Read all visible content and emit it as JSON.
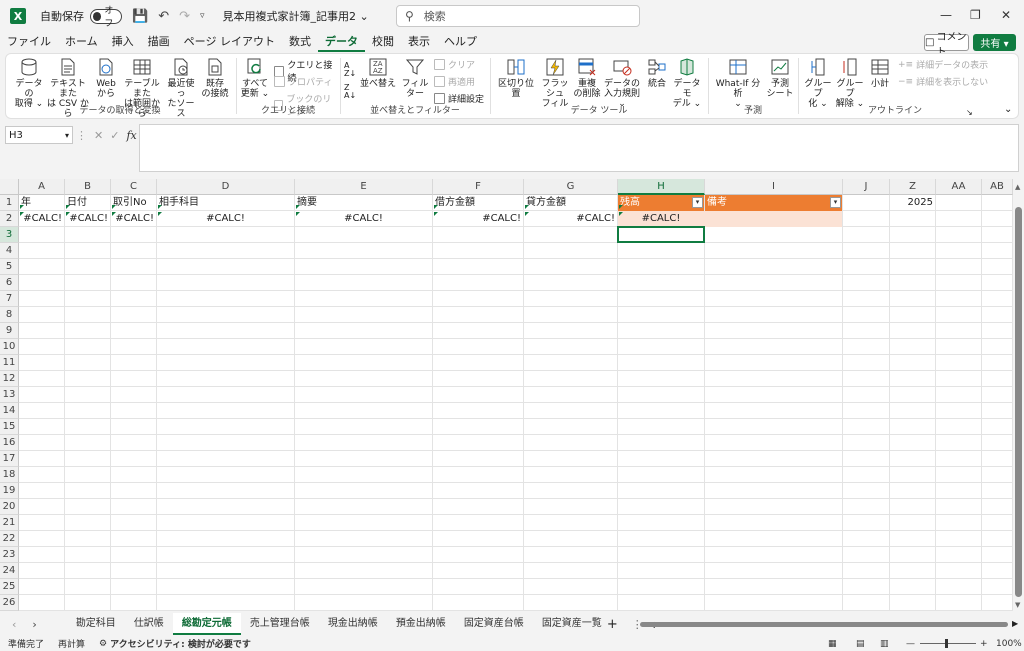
{
  "app": {
    "autosave_label": "自動保存",
    "autosave_state": "オフ",
    "doc_title": "見本用複式家計簿_記事用2 ⌄",
    "search_placeholder": "検索"
  },
  "menu": {
    "items": [
      "ファイル",
      "ホーム",
      "挿入",
      "描画",
      "ページ レイアウト",
      "数式",
      "データ",
      "校閲",
      "表示",
      "ヘルプ"
    ],
    "active_index": 6,
    "comment_label": "コメント",
    "share_label": "共有 ▾"
  },
  "ribbon": {
    "get_data": {
      "label": "データの取得と変換",
      "buttons": [
        {
          "l1": "データの",
          "l2": "取得 ⌄"
        },
        {
          "l1": "テキストまた",
          "l2": "は CSV から"
        },
        {
          "l1": "Web",
          "l2": "から"
        },
        {
          "l1": "テーブルまた",
          "l2": "は範囲から"
        },
        {
          "l1": "最近使っ",
          "l2": "たソース"
        },
        {
          "l1": "既存",
          "l2": "の接続"
        }
      ]
    },
    "queries": {
      "label": "クエリと接続",
      "refresh": {
        "l1": "すべて",
        "l2": "更新 ⌄"
      },
      "small": [
        "クエリと接続",
        "プロパティ",
        "ブックのリンク"
      ]
    },
    "sort": {
      "label": "並べ替えとフィルター",
      "sort_btn": "並べ替え",
      "filter_btn": "フィルター",
      "small": [
        "クリア",
        "再適用",
        "詳細設定"
      ]
    },
    "tools": {
      "label": "データ ツール",
      "buttons": [
        {
          "l1": "区切り位置",
          "l2": ""
        },
        {
          "l1": "フラッシュ",
          "l2": "フィル"
        },
        {
          "l1": "重複",
          "l2": "の削除"
        },
        {
          "l1": "データの",
          "l2": "入力規則 ⌄"
        },
        {
          "l1": "統合",
          "l2": ""
        },
        {
          "l1": "データ モ",
          "l2": "デル ⌄"
        }
      ]
    },
    "forecast": {
      "label": "予測",
      "buttons": [
        {
          "l1": "What-If 分析",
          "l2": "⌄"
        },
        {
          "l1": "予測",
          "l2": "シート"
        }
      ]
    },
    "outline": {
      "label": "アウトライン",
      "buttons": [
        {
          "l1": "グループ",
          "l2": "化 ⌄"
        },
        {
          "l1": "グループ",
          "l2": "解除 ⌄"
        },
        {
          "l1": "小計",
          "l2": ""
        }
      ],
      "small": [
        "詳細データの表示",
        "詳細を表示しない"
      ]
    }
  },
  "formula": {
    "namebox": "H3",
    "fx": "fx",
    "content": ""
  },
  "grid": {
    "columns": [
      "A",
      "B",
      "C",
      "D",
      "E",
      "F",
      "G",
      "H",
      "I",
      "J",
      "Z",
      "AA",
      "AB"
    ],
    "rows": [
      "1",
      "2",
      "3",
      "4",
      "5",
      "6",
      "7",
      "8",
      "9",
      "10",
      "11",
      "12",
      "13",
      "14",
      "15",
      "16",
      "17",
      "18",
      "19",
      "20",
      "21",
      "22",
      "23",
      "24",
      "25",
      "26"
    ],
    "row1": {
      "A": "年",
      "B": "日付",
      "C": "取引No",
      "D": "相手科目",
      "E": "摘要",
      "F": "借方金額",
      "G": "貸方金額",
      "H": "残高",
      "I": "備考",
      "Z": "2025"
    },
    "row2": {
      "A": "#CALC!",
      "B": "#CALC!",
      "C": "#CALC!",
      "D": "#CALC!",
      "E": "#CALC!",
      "F": "#CALC!",
      "G": "#CALC!",
      "H": "#CALC!"
    },
    "filter_glyph": "▾",
    "selected_cell": "H3"
  },
  "sheets": {
    "tabs": [
      "勘定科目",
      "仕訳帳",
      "総勘定元帳",
      "売上管理台帳",
      "現金出納帳",
      "預金出納帳",
      "固定資産台帳",
      "固定資産一覧 ..."
    ],
    "active_index": 2,
    "add": "+"
  },
  "status": {
    "ready": "準備完了",
    "recalc": "再計算",
    "accessibility": "アクセシビリティ: 検討が必要です",
    "zoom": "100%"
  },
  "colors": {
    "accent": "#107c41",
    "table_header": "#ed7d31",
    "table_band": "#fbe2d5"
  }
}
